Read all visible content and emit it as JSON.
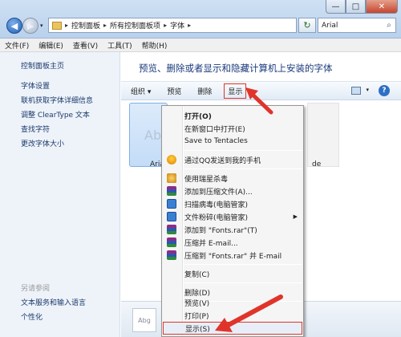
{
  "window": {
    "minimize": "—",
    "maximize": "□",
    "close": "✕"
  },
  "address": {
    "crumbs": [
      "控制面板",
      "所有控制面板项",
      "字体"
    ],
    "separator": "▸"
  },
  "search": {
    "value": "Arial"
  },
  "menu": [
    "文件(F)",
    "编辑(E)",
    "查看(V)",
    "工具(T)",
    "帮助(H)"
  ],
  "sidebar": {
    "home": "控制面板主页",
    "links": [
      "字体设置",
      "联机获取字体详细信息",
      "调整 ClearType 文本",
      "查找字符",
      "更改字体大小"
    ],
    "see_also_title": "另请参阅",
    "see_also": [
      "文本服务和输入语言",
      "个性化"
    ]
  },
  "content": {
    "title": "预览、删除或者显示和隐藏计算机上安装的字体"
  },
  "toolbar": {
    "organize": "组织 ▾",
    "preview": "预览",
    "delete": "删除",
    "show": "显示"
  },
  "tiles": {
    "ab_text": "Ab",
    "label_left": "Aria",
    "label_right": "de",
    "status_thumb": "Abg"
  },
  "context_menu": {
    "items": [
      {
        "label": "打开(O)"
      },
      {
        "label": "在新窗口中打开(E)"
      },
      {
        "label": "Save to Tentacles"
      },
      {
        "label": "通过QQ发送到我的手机"
      },
      {
        "label": "使用瑞星杀毒"
      },
      {
        "label": "添加到压缩文件(A)..."
      },
      {
        "label": "扫描病毒(电脑管家)"
      },
      {
        "label": "文件粉碎(电脑管家)"
      },
      {
        "label": "添加到 \"Fonts.rar\"(T)"
      },
      {
        "label": "压缩并 E-mail..."
      },
      {
        "label": "压缩到 \"Fonts.rar\" 并 E-mail"
      },
      {
        "label": "复制(C)"
      },
      {
        "label": "删除(D)"
      },
      {
        "label": "预览(V)"
      },
      {
        "label": "打印(P)"
      },
      {
        "label": "显示(S)"
      }
    ],
    "submenu_arrow": "▶"
  }
}
